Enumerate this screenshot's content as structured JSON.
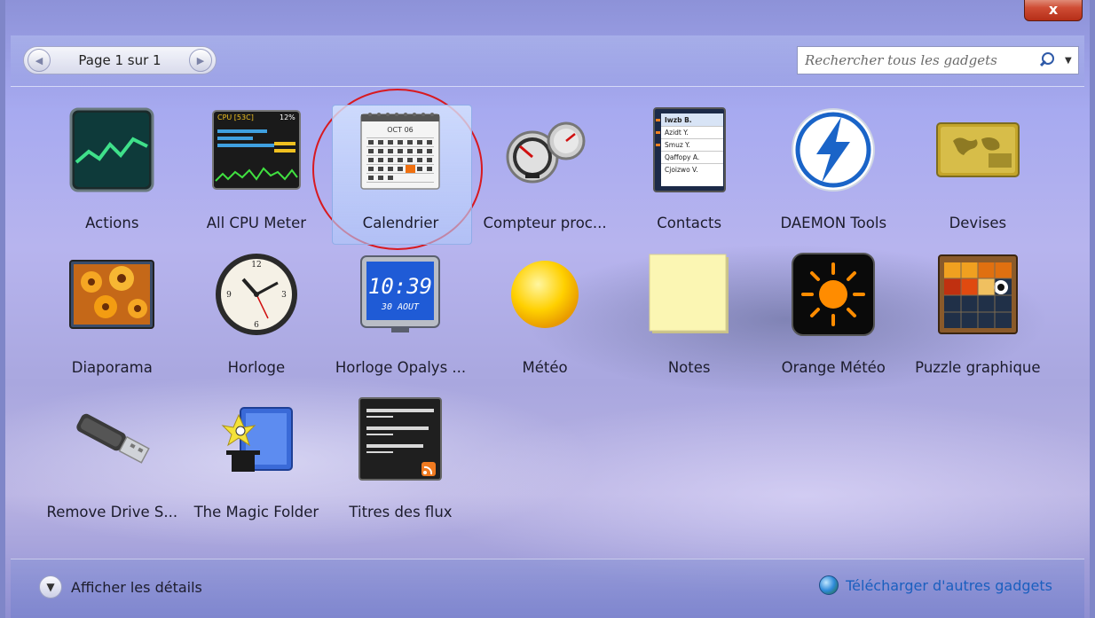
{
  "window": {
    "close_glyph": "x"
  },
  "pager": {
    "label": "Page 1 sur 1",
    "prev": "◀",
    "next": "▶"
  },
  "search": {
    "placeholder": "Rechercher tous les gadgets",
    "dropdown_glyph": "▼"
  },
  "gadgets": [
    {
      "label": "Actions",
      "icon": "stock-chart-icon"
    },
    {
      "label": "All CPU Meter",
      "icon": "cpu-meter-icon"
    },
    {
      "label": "Calendrier",
      "icon": "calendar-icon",
      "selected": true
    },
    {
      "label": "Compteur proc...",
      "icon": "cpu-gauge-icon"
    },
    {
      "label": "Contacts",
      "icon": "contacts-icon"
    },
    {
      "label": "DAEMON Tools",
      "icon": "daemon-tools-icon"
    },
    {
      "label": "Devises",
      "icon": "currency-card-icon"
    },
    {
      "label": "Diaporama",
      "icon": "slideshow-icon"
    },
    {
      "label": "Horloge",
      "icon": "clock-icon"
    },
    {
      "label": "Horloge Opalys ...",
      "icon": "digital-clock-icon"
    },
    {
      "label": "Météo",
      "icon": "sun-icon"
    },
    {
      "label": "Notes",
      "icon": "sticky-note-icon"
    },
    {
      "label": "Orange Météo",
      "icon": "orange-weather-icon"
    },
    {
      "label": "Puzzle graphique",
      "icon": "puzzle-icon"
    },
    {
      "label": "Remove Drive S...",
      "icon": "usb-drive-icon"
    },
    {
      "label": "The Magic Folder",
      "icon": "magic-folder-icon"
    },
    {
      "label": "Titres des flux",
      "icon": "feed-headlines-icon"
    }
  ],
  "calendar_icon": {
    "month": "OCT 06"
  },
  "digital_clock": {
    "time": "10:39",
    "date": "30 AOUT"
  },
  "contacts_icon": {
    "names": [
      "Iwzb B.",
      "Azidt Y.",
      "Smuz Y.",
      "Qaffopy A.",
      "Cjoizwo V."
    ]
  },
  "cpu_meter_icon": {
    "header": "CPU [53C]",
    "pct": "12%"
  },
  "bottom": {
    "details_label": "Afficher les détails",
    "download_label": "Télécharger d'autres gadgets"
  }
}
